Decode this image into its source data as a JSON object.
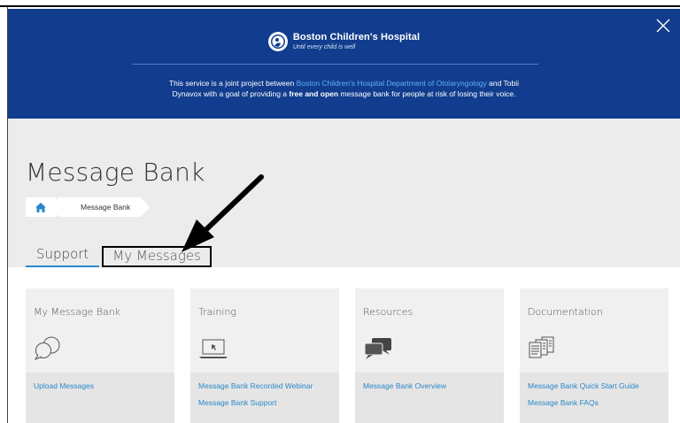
{
  "banner": {
    "close_label": "✕",
    "logo_name": "Boston Children's Hospital",
    "logo_tagline": "Until every child is well",
    "text_1": "This service is a joint project between ",
    "text_link": "Boston Children's Hospital Department of Otolaryngology",
    "text_2": " and Tobii",
    "text_3": "Dynavox with a goal of providing a ",
    "text_bold": "free and open",
    "text_4": " message bank for people at risk of losing their voice."
  },
  "page": {
    "title": "Message Bank",
    "breadcrumb_current": "Message Bank"
  },
  "tabs": [
    {
      "label": "Support",
      "active": true
    },
    {
      "label": "My Messages",
      "active": false
    }
  ],
  "cards": [
    {
      "title": "My Message Bank",
      "icon": "chat-bubbles-icon",
      "links": [
        "Upload Messages"
      ]
    },
    {
      "title": "Training",
      "icon": "laptop-icon",
      "links": [
        "Message Bank Recorded Webinar",
        "Message Bank Support"
      ]
    },
    {
      "title": "Resources",
      "icon": "speech-bubbles-icon",
      "links": [
        "Message Bank Overview"
      ]
    },
    {
      "title": "Documentation",
      "icon": "documents-icon",
      "links": [
        "Message Bank Quick Start Guide",
        "Message Bank FAQs"
      ]
    }
  ],
  "colors": {
    "banner": "#123d8e",
    "link": "#2a87c9",
    "page_bg": "#ececec"
  }
}
